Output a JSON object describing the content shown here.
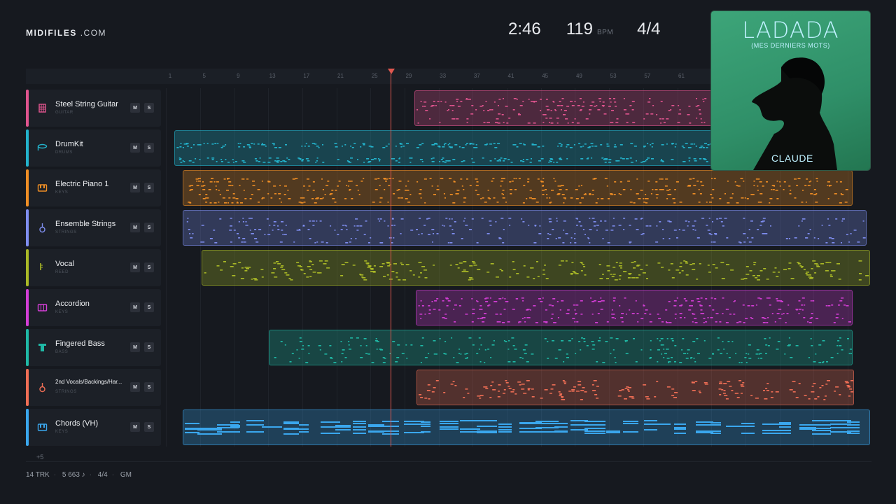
{
  "brand": {
    "name": "MIDIFILES",
    "suffix": ".COM"
  },
  "transport": {
    "time": "2:46",
    "tempo": "119",
    "tempo_unit": "BPM",
    "time_signature": "4/4"
  },
  "ruler": {
    "ticks": [
      "1",
      "5",
      "9",
      "13",
      "17",
      "21",
      "25",
      "29",
      "33",
      "37",
      "41",
      "45",
      "49",
      "53",
      "57",
      "61"
    ]
  },
  "tracks": [
    {
      "name": "Steel String Guitar",
      "category": "GUITAR",
      "color": "#e0548e",
      "icon": "guitar-icon",
      "mute": "M",
      "solo": "S"
    },
    {
      "name": "DrumKit",
      "category": "DRUMS",
      "color": "#23b3cc",
      "icon": "drum-icon",
      "mute": "M",
      "solo": "S"
    },
    {
      "name": "Electric Piano 1",
      "category": "KEYS",
      "color": "#ef8e25",
      "icon": "piano-icon",
      "mute": "M",
      "solo": "S"
    },
    {
      "name": "Ensemble Strings",
      "category": "STRINGS",
      "color": "#7f8ef0",
      "icon": "violin-icon",
      "mute": "M",
      "solo": "S"
    },
    {
      "name": "Vocal",
      "category": "REED",
      "color": "#aab926",
      "icon": "saxophone-icon",
      "mute": "M",
      "solo": "S"
    },
    {
      "name": "Accordion",
      "category": "KEYS",
      "color": "#d43ed6",
      "icon": "accordion-icon",
      "mute": "M",
      "solo": "S"
    },
    {
      "name": "Fingered Bass",
      "category": "BASS",
      "color": "#1fb9a6",
      "icon": "bass-icon",
      "mute": "M",
      "solo": "S"
    },
    {
      "name": "2nd Vocals/Backings/Har...",
      "category": "STRINGS",
      "color": "#f06e55",
      "icon": "violin-icon",
      "mute": "M",
      "solo": "S"
    },
    {
      "name": "Chords (VH)",
      "category": "KEYS",
      "color": "#3aa7ee",
      "icon": "piano-icon",
      "mute": "M",
      "solo": "S"
    }
  ],
  "more_tracks": "+5",
  "footer": {
    "tracks": "14 TRK",
    "notes": "5 663 ♪",
    "signature": "4/4",
    "standard": "GM"
  },
  "album": {
    "title": "LADADA",
    "subtitle": "(MES DERNIERS MOTS)",
    "artist": "CLAUDE"
  }
}
